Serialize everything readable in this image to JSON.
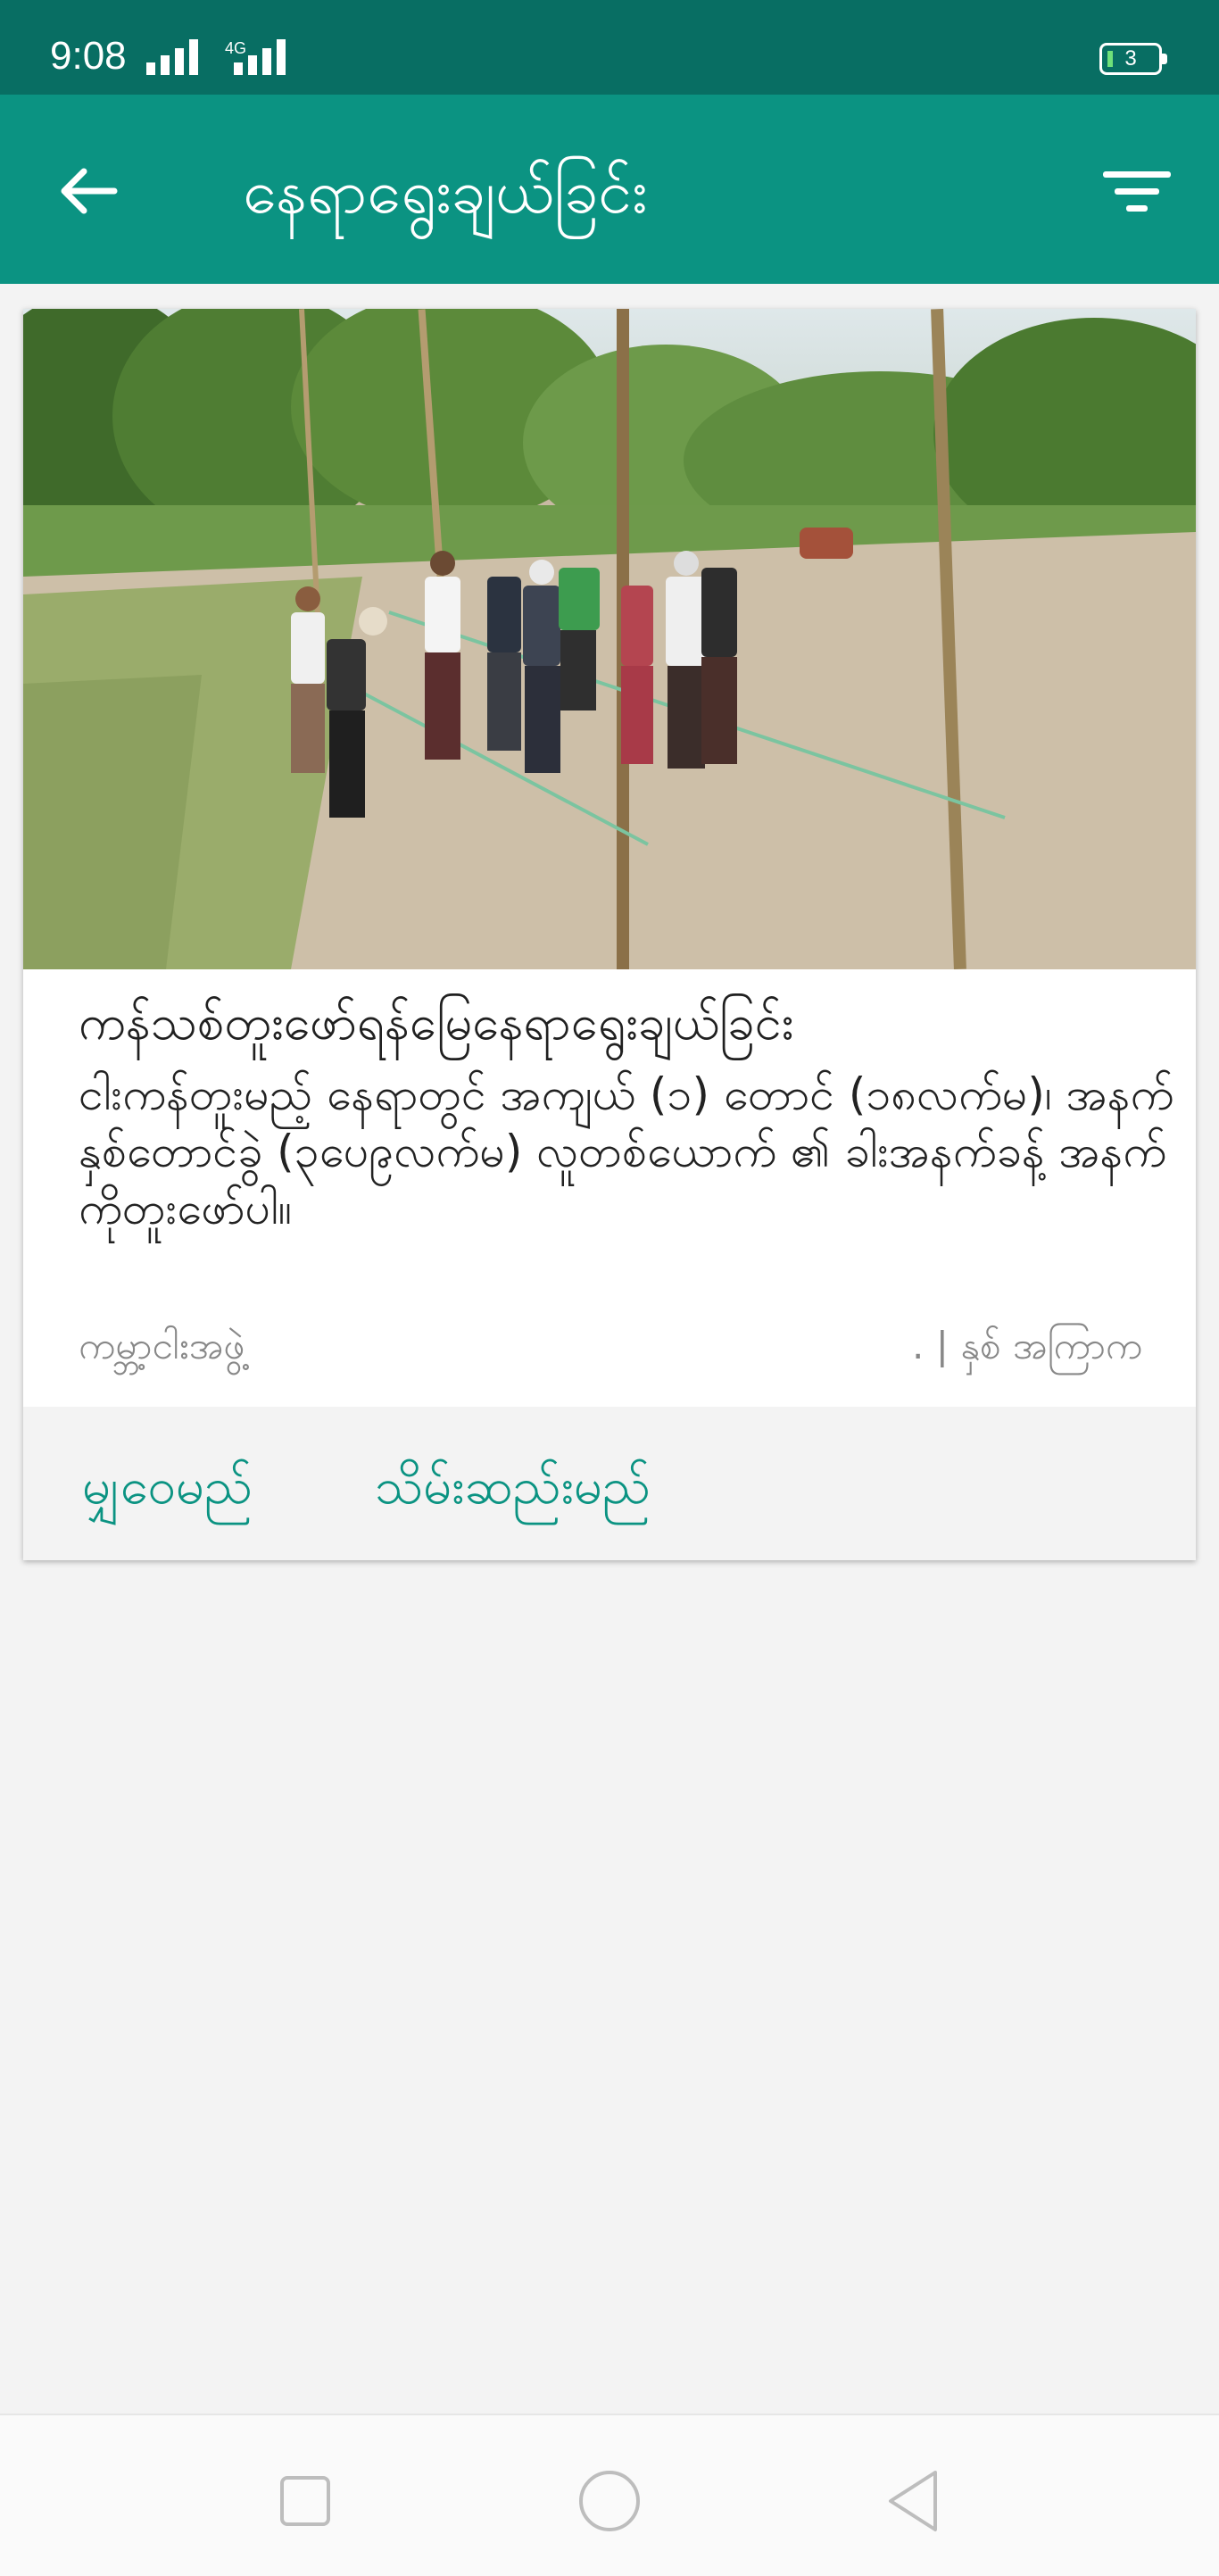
{
  "status_bar": {
    "time": "9:08",
    "network_label": "4G",
    "battery_level": "3",
    "battery_color": "#6fe07a"
  },
  "app_bar": {
    "title": "နေရာရွေးချယ်ခြင်း",
    "back_icon": "arrow-left-icon",
    "filter_icon": "filter-icon"
  },
  "card": {
    "image_alt": "people measuring field",
    "title": "ကန်သစ်တူးဖော်ရန်မြေနေရာရွေးချယ်ခြင်း",
    "description": "ငါးကန်တူးမည့် နေရာတွင် အကျယ် (၁) တောင် (၁၈လက်မ)၊ အနက် နှစ်တောင်ခွဲ (၃ပေ၉လက်မ) လူတစ်ယောက် ၏ ခါးအနက်ခန့် အနက်ကိုတူးဖော်ပါ။",
    "source": "ကမ္ဘာ့ငါးအဖွဲ့",
    "time": ". | နှစ် အကြာက",
    "actions": {
      "share": "မျှဝေမည်",
      "save": "သိမ်းဆည်းမည်"
    }
  },
  "nav_bar": {
    "recents_icon": "square-icon",
    "home_icon": "circle-icon",
    "back_icon": "triangle-back-icon"
  },
  "colors": {
    "status_bar": "#086e63",
    "app_bar": "#0b9382",
    "accent": "#0b9382"
  }
}
